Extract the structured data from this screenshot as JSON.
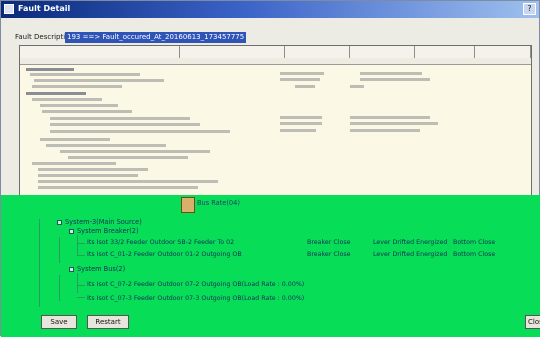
{
  "window": {
    "title": "Fault Detail",
    "close_label": "?"
  },
  "fault": {
    "label": "Fault Description",
    "value": "193 ==> Fault_occured_At_20160613_173457775"
  },
  "tree": {
    "items": [
      "Bus Rate(04)",
      "System-3(Main Source)",
      "System Breaker(2)",
      "Its Isot 33/2 Feeder Outdoor SB-2 Feeder To 02",
      "Its Isot C_01-2 Feeder Outdoor 01-2 Outgoing OB",
      "System Bus(2)",
      "Its Isot C_07-2 Feeder Outdoor 07-2 Outgoing OB(Load Rate : 0.00%)",
      "Its Isot C_07-3 Feeder Outdoor 07-3 Outgoing OB(Load Rate : 0.00%)"
    ],
    "row_details": [
      {
        "status": "Breaker Close",
        "detail": "Lever Drifted Energized",
        "extra": "Bottom Close"
      },
      {
        "status": "Breaker Close",
        "detail": "Lever Drifted Energized",
        "extra": "Bottom Close"
      }
    ]
  },
  "buttons": {
    "save": "Save",
    "restart": "Restart",
    "close": "Close"
  }
}
